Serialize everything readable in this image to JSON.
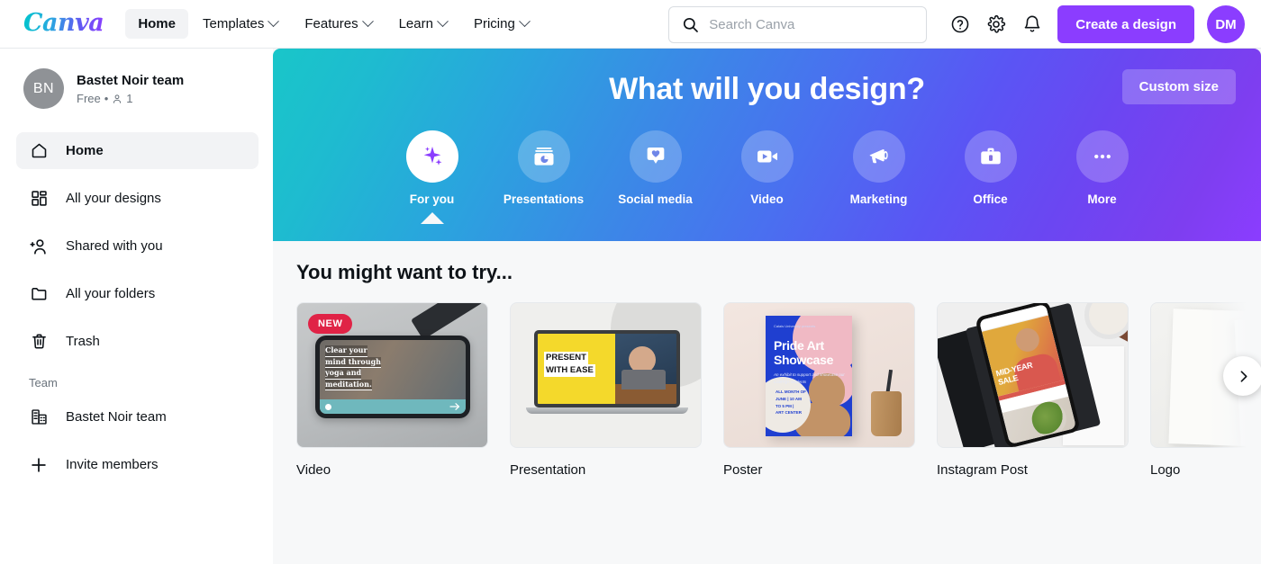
{
  "header": {
    "logo_text": "Canva",
    "nav": [
      {
        "label": "Home",
        "active": true,
        "caret": false
      },
      {
        "label": "Templates",
        "active": false,
        "caret": true
      },
      {
        "label": "Features",
        "active": false,
        "caret": true
      },
      {
        "label": "Learn",
        "active": false,
        "caret": true
      },
      {
        "label": "Pricing",
        "active": false,
        "caret": true
      }
    ],
    "search": {
      "placeholder": "Search Canva",
      "value": "",
      "icon": "search-icon"
    },
    "icons": [
      "help-icon",
      "gear-icon",
      "bell-icon"
    ],
    "create_button": "Create a design",
    "avatar_initials": "DM",
    "accent_color": "#8b3dff"
  },
  "sidebar": {
    "team": {
      "avatar_initials": "BN",
      "name": "Bastet Noir team",
      "plan": "Free",
      "separator": "•",
      "member_icon": "person-icon",
      "member_count": "1"
    },
    "items": [
      {
        "label": "Home",
        "icon": "home-icon",
        "active": true
      },
      {
        "label": "All your designs",
        "icon": "grid-icon",
        "active": false
      },
      {
        "label": "Shared with you",
        "icon": "shared-people-icon",
        "active": false
      },
      {
        "label": "All your folders",
        "icon": "folder-icon",
        "active": false
      },
      {
        "label": "Trash",
        "icon": "trash-icon",
        "active": false
      }
    ],
    "group_title": "Team",
    "team_items": [
      {
        "label": "Bastet Noir team",
        "icon": "building-icon"
      },
      {
        "label": "Invite members",
        "icon": "plus-icon"
      }
    ]
  },
  "hero": {
    "title": "What will you design?",
    "custom_size_button": "Custom size",
    "gradient_from": "#19c6c9",
    "gradient_to": "#8b3dff",
    "categories": [
      {
        "label": "For you",
        "icon": "sparkle-icon",
        "active": true
      },
      {
        "label": "Presentations",
        "icon": "presentation-icon",
        "active": false
      },
      {
        "label": "Social media",
        "icon": "heart-bubble-icon",
        "active": false
      },
      {
        "label": "Video",
        "icon": "video-camera-icon",
        "active": false
      },
      {
        "label": "Marketing",
        "icon": "megaphone-icon",
        "active": false
      },
      {
        "label": "Office",
        "icon": "briefcase-icon",
        "active": false
      },
      {
        "label": "More",
        "icon": "ellipsis-icon",
        "active": false
      }
    ]
  },
  "main": {
    "section_title": "You might want to try...",
    "scroll_next_icon": "chevron-right-icon",
    "cards": [
      {
        "label": "Video",
        "badge": "NEW",
        "badge_color": "#e02346",
        "art": "video",
        "art_text": {
          "line1": "Clear your",
          "line2": "mind through",
          "line3": "yoga and",
          "line4": "meditation."
        }
      },
      {
        "label": "Presentation",
        "badge": null,
        "art": "presentation",
        "art_text": {
          "line1": "PRESENT",
          "line2": "WITH EASE"
        }
      },
      {
        "label": "Poster",
        "badge": null,
        "art": "poster",
        "art_text": {
          "eyebrow": "Calais University presents",
          "title1": "Pride Art",
          "title2": "Showcase",
          "body": "An exhibit to support and showcase our LGBTQ+ students",
          "footer1": "ALL MONTH OF",
          "footer2": "JUNE | 10 AM",
          "footer3": "TO 5 PM |",
          "footer4": "ART CENTER"
        }
      },
      {
        "label": "Instagram Post",
        "badge": null,
        "art": "instagram",
        "art_text": {
          "line1": "MID-YEAR",
          "line2": "SALE"
        }
      },
      {
        "label": "Logo",
        "badge": null,
        "art": "logo",
        "art_text": {}
      }
    ]
  }
}
